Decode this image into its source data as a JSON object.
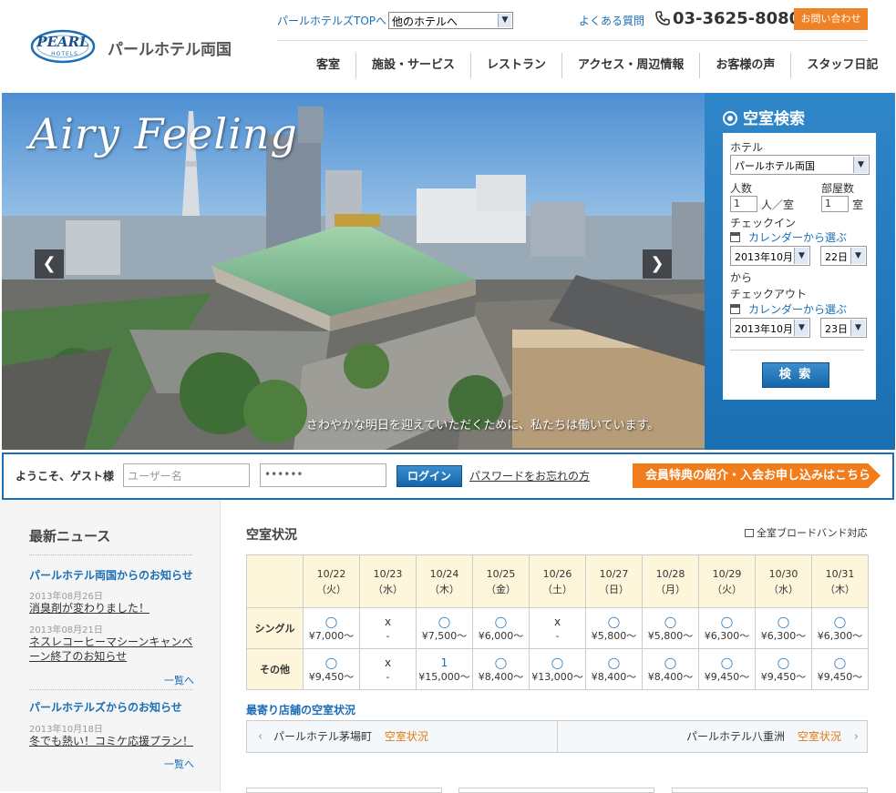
{
  "header": {
    "logo_brand": "PEARL",
    "logo_sub": "HOTELS",
    "hotel_name": "パールホテル両国",
    "top_link": "パールホテルズTOPへ",
    "hotel_select": "他のホテルへ",
    "faq": "よくある質問",
    "phone": "03-3625-8080",
    "contact": "お問い合わせ"
  },
  "nav": [
    "客室",
    "施設・サービス",
    "レストラン",
    "アクセス・周辺情報",
    "お客様の声",
    "スタッフ日記"
  ],
  "hero": {
    "title": "Airy Feeling",
    "caption": "さわやかな明日を迎えていただくために、私たちは働いています。",
    "prev": "❮",
    "next": "❯"
  },
  "search": {
    "title": "空室検索",
    "hotel_label": "ホテル",
    "hotel_value": "パールホテル両国",
    "people_label": "人数",
    "people_value": "1",
    "people_unit": "人／室",
    "rooms_label": "部屋数",
    "rooms_value": "1",
    "rooms_unit": "室",
    "checkin_label": "チェックイン",
    "calendar_link": "カレンダーから選ぶ",
    "checkin_month": "2013年10月",
    "checkin_day": "22日",
    "from": "から",
    "checkout_label": "チェックアウト",
    "checkout_month": "2013年10月",
    "checkout_day": "23日",
    "button": "検 索"
  },
  "login": {
    "welcome": "ようこそ、ゲスト様",
    "user_placeholder": "ユーザー名",
    "password_value": "••••••",
    "button": "ログイン",
    "forgot": "パスワードをお忘れの方",
    "member": "会員特典の紹介・入会お申し込みはこちら"
  },
  "news": {
    "title": "最新ニュース",
    "groups": [
      {
        "heading": "パールホテル両国からのお知らせ",
        "items": [
          {
            "date": "2013年08月26日",
            "text": "消臭剤が変わりました！"
          },
          {
            "date": "2013年08月21日",
            "text": "ネスレコーヒーマシーンキャンペーン終了のお知らせ"
          }
        ],
        "more": "一覧へ"
      },
      {
        "heading": "パールホテルズからのお知らせ",
        "items": [
          {
            "date": "2013年10月18日",
            "text": "冬でも熱い！コミケ応援プラン！"
          }
        ],
        "more": "一覧へ"
      }
    ]
  },
  "availability": {
    "title": "空室状況",
    "broadband": "全室ブロードバンド対応",
    "dates": [
      {
        "d": "10/22",
        "w": "（火）"
      },
      {
        "d": "10/23",
        "w": "（水）"
      },
      {
        "d": "10/24",
        "w": "（木）"
      },
      {
        "d": "10/25",
        "w": "（金）"
      },
      {
        "d": "10/26",
        "w": "（土）"
      },
      {
        "d": "10/27",
        "w": "（日）"
      },
      {
        "d": "10/28",
        "w": "（月）"
      },
      {
        "d": "10/29",
        "w": "（火）"
      },
      {
        "d": "10/30",
        "w": "（水）"
      },
      {
        "d": "10/31",
        "w": "（木）"
      }
    ],
    "rows": [
      {
        "label": "シングル",
        "cells": [
          {
            "m": "◯",
            "p": "¥7,000～"
          },
          {
            "m": "x",
            "p": "-"
          },
          {
            "m": "◯",
            "p": "¥7,500～"
          },
          {
            "m": "◯",
            "p": "¥6,000～"
          },
          {
            "m": "x",
            "p": "-"
          },
          {
            "m": "◯",
            "p": "¥5,800～"
          },
          {
            "m": "◯",
            "p": "¥5,800～"
          },
          {
            "m": "◯",
            "p": "¥6,300～"
          },
          {
            "m": "◯",
            "p": "¥6,300～"
          },
          {
            "m": "◯",
            "p": "¥6,300～"
          }
        ]
      },
      {
        "label": "その他",
        "cells": [
          {
            "m": "◯",
            "p": "¥9,450～"
          },
          {
            "m": "x",
            "p": "-"
          },
          {
            "m": "1",
            "p": "¥15,000～"
          },
          {
            "m": "◯",
            "p": "¥8,400～"
          },
          {
            "m": "◯",
            "p": "¥13,000～"
          },
          {
            "m": "◯",
            "p": "¥8,400～"
          },
          {
            "m": "◯",
            "p": "¥8,400～"
          },
          {
            "m": "◯",
            "p": "¥9,450～"
          },
          {
            "m": "◯",
            "p": "¥9,450～"
          },
          {
            "m": "◯",
            "p": "¥9,450～"
          }
        ]
      }
    ],
    "nearby_title": "最寄り店舗の空室状況",
    "nearby_left": "パールホテル茅場町",
    "nearby_right": "パールホテル八重洲",
    "nearby_status": "空室状況"
  },
  "colors": {
    "accent": "#1a6eb5",
    "orange": "#f08226",
    "table_head": "#fdf6da"
  }
}
